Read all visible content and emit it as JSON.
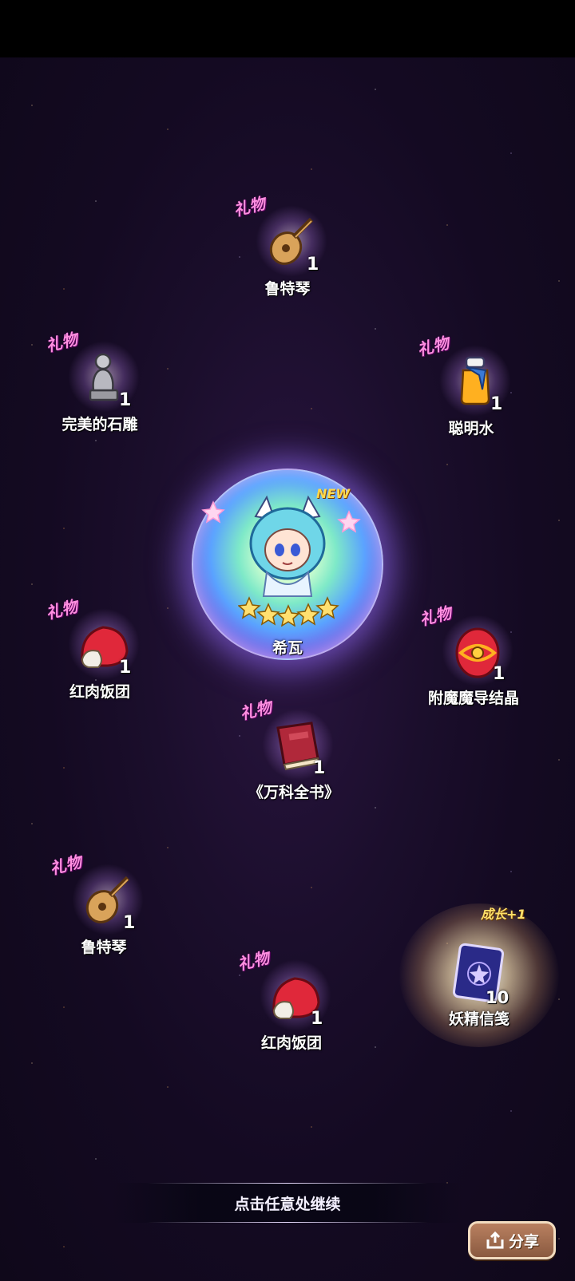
{
  "hero": {
    "name": "希瓦",
    "badge": "NEW",
    "stars": 5
  },
  "items": [
    {
      "tag": "礼物",
      "name": "鲁特琴",
      "count": "1",
      "icon": "lute-icon"
    },
    {
      "tag": "礼物",
      "name": "完美的石雕",
      "count": "1",
      "icon": "statue-icon"
    },
    {
      "tag": "礼物",
      "name": "聪明水",
      "count": "1",
      "icon": "potion-icon"
    },
    {
      "tag": "礼物",
      "name": "红肉饭团",
      "count": "1",
      "icon": "rice-ball-icon"
    },
    {
      "tag": "礼物",
      "name": "附魔魔导结晶",
      "count": "1",
      "icon": "crystal-icon"
    },
    {
      "tag": "礼物",
      "name": "《万科全书》",
      "count": "1",
      "icon": "book-icon"
    },
    {
      "tag": "礼物",
      "name": "鲁特琴",
      "count": "1",
      "icon": "lute-icon"
    },
    {
      "tag": "礼物",
      "name": "红肉饭团",
      "count": "1",
      "icon": "rice-ball-icon"
    }
  ],
  "special": {
    "growth": "成长+1",
    "name": "妖精信笺",
    "count": "10",
    "icon": "fairy-letter-icon"
  },
  "continue_text": "点击任意处继续",
  "share_label": "分享"
}
